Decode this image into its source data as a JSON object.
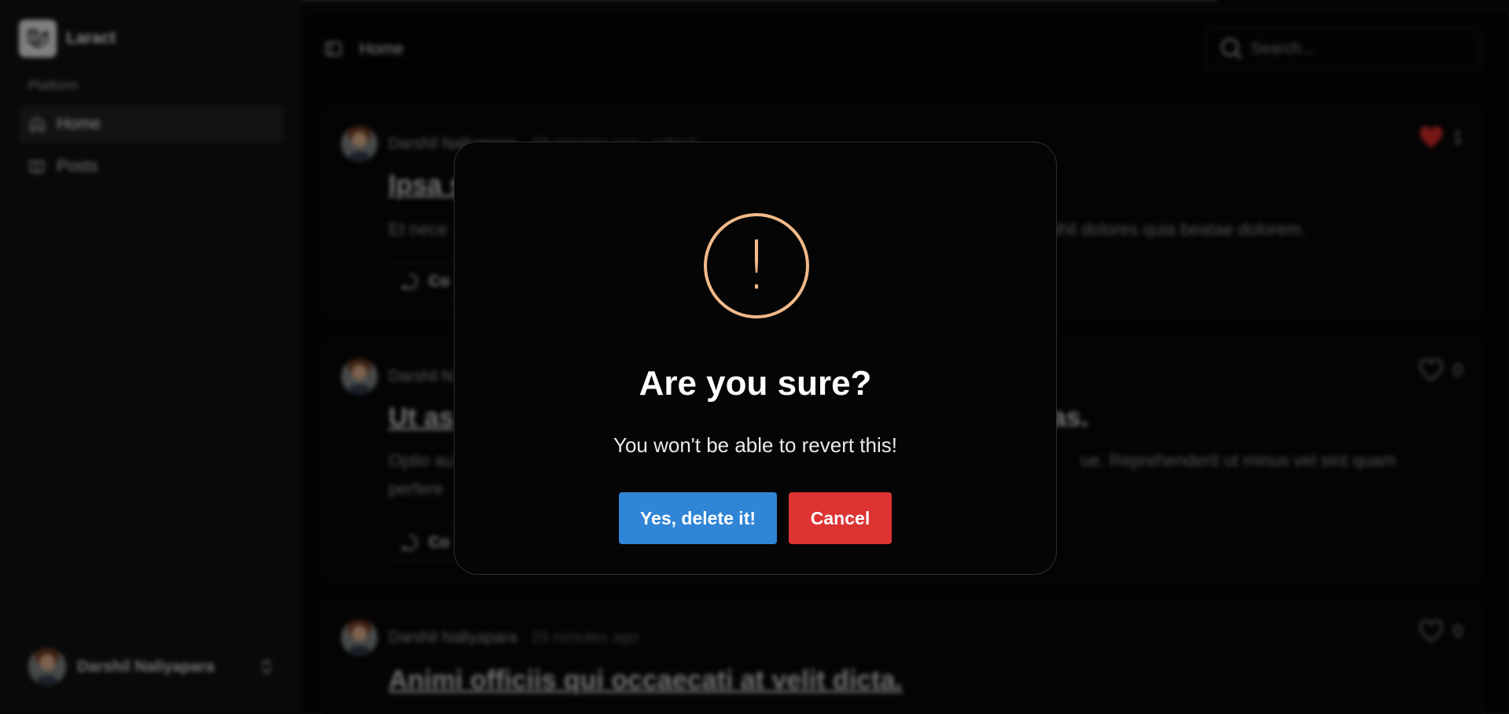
{
  "app": {
    "name": "Laract"
  },
  "sidebar": {
    "section_label": "Platform",
    "items": [
      {
        "label": "Home",
        "icon": "home-icon",
        "active": true
      },
      {
        "label": "Posts",
        "icon": "book-icon",
        "active": false
      }
    ],
    "user": {
      "name": "Darshil Naliyapara"
    }
  },
  "header": {
    "title": "Home",
    "search_placeholder": "Search..."
  },
  "posts": [
    {
      "author": "Darshil Naliyapara",
      "time": "29 minutes ago",
      "edited": "edited",
      "title": "Ipsa s",
      "body": "Et nece",
      "body_tail": "nihil dolores quia beatae dolorem.",
      "likes": "1",
      "liked": true,
      "comment_label": "Co"
    },
    {
      "author": "Darshil N",
      "title": "Ut as",
      "title_tail": "alias.",
      "body": "Optio au",
      "body_tail": "ue. Reprehenderit ut minus vel sint quam",
      "body_line2": "perfere",
      "likes": "0",
      "liked": false,
      "comment_label": "Co"
    },
    {
      "author": "Darshil Naliyapara",
      "time": "29 minutes ago",
      "title": "Animi officiis qui occaecati at velit dicta.",
      "likes": "0",
      "liked": false
    }
  ],
  "modal": {
    "icon": "!",
    "title": "Are you sure?",
    "text": "You won't be able to revert this!",
    "confirm_label": "Yes, delete it!",
    "cancel_label": "Cancel"
  },
  "colors": {
    "confirm": "#3085d6",
    "cancel": "#dd3333",
    "warning": "#f2b98a",
    "like": "#d92a2a"
  }
}
